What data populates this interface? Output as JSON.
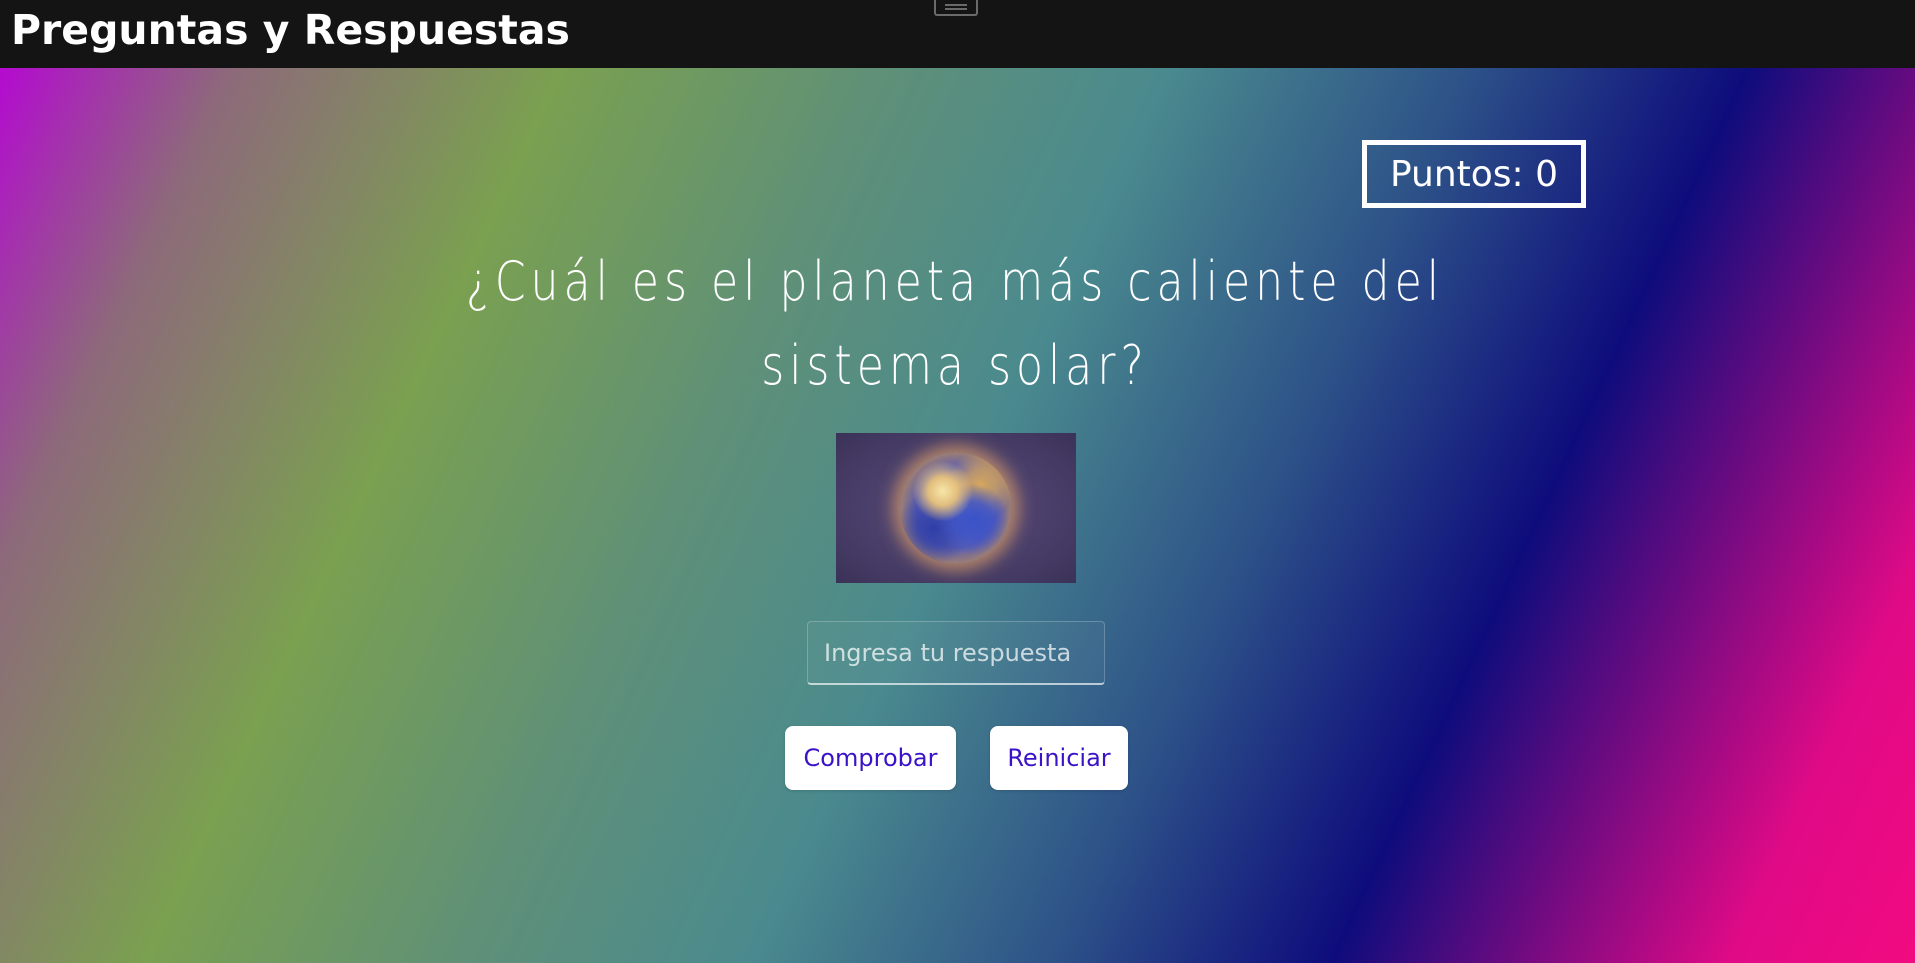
{
  "header": {
    "title": "Preguntas y Respuestas"
  },
  "score": {
    "text": "Puntos: 0"
  },
  "quiz": {
    "question": "¿Cuál es el planeta más caliente del sistema solar?",
    "image_icon": "planet-venus-image",
    "answer_placeholder": "Ingresa tu respuesta",
    "answer_value": ""
  },
  "actions": {
    "check_label": "Comprobar",
    "reset_label": "Reiniciar"
  },
  "colors": {
    "topbar": "#141414",
    "button_text": "#3b12c8",
    "gradient": [
      "#b40ad0",
      "#7aa050",
      "#4a8a8e",
      "#0e0c7c",
      "#f20a80"
    ]
  }
}
